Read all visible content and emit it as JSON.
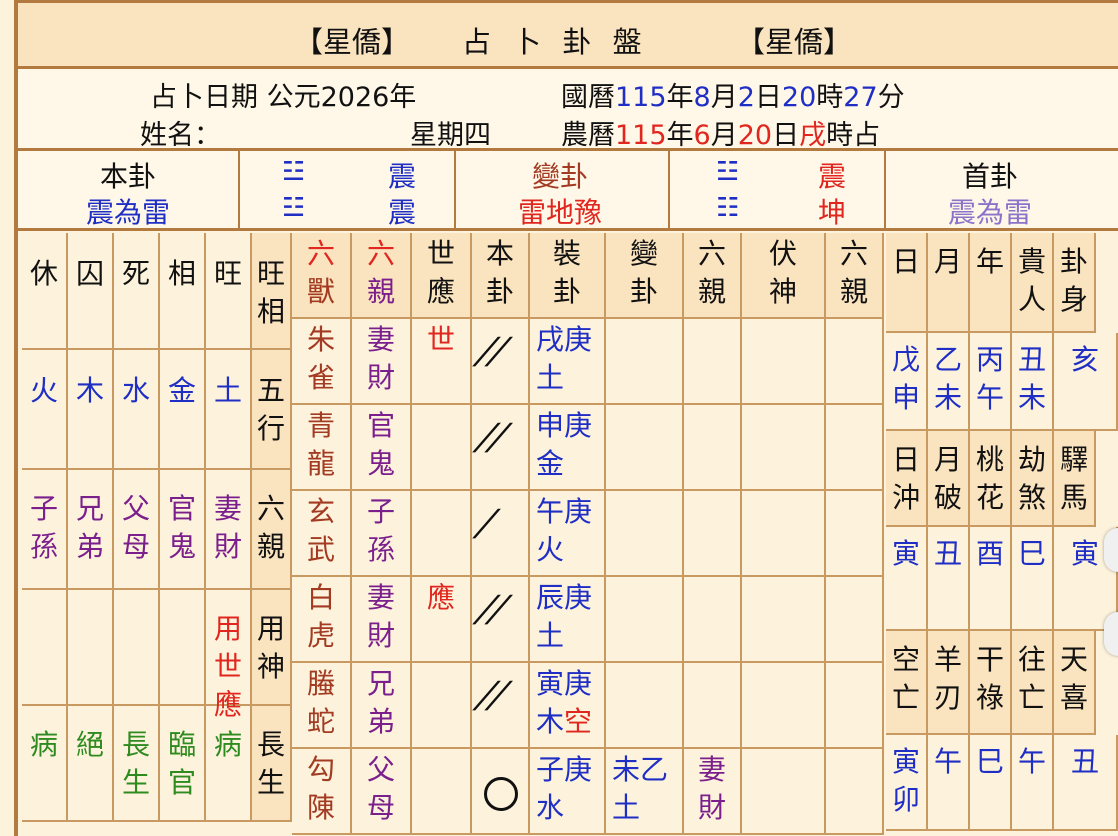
{
  "header": {
    "left_tag": "【星僑】",
    "title": "占 卜 卦 盤",
    "right_tag": "【星僑】"
  },
  "info": {
    "date_label": "占卜日期 公元2026年",
    "name_label": "姓名：",
    "weekday": "星期四",
    "greg_prefix": "國曆",
    "greg_year": "115",
    "greg_y": "年",
    "greg_month": "8",
    "greg_m": "月",
    "greg_day": "2",
    "greg_d": "日",
    "greg_hour": "20",
    "greg_h": "時",
    "greg_min": "27",
    "greg_mn": "分",
    "lunar_prefix": "農曆",
    "lunar_year": "115",
    "lunar_y": "年",
    "lunar_month": "6",
    "lunar_m": "月",
    "lunar_day": "20",
    "lunar_d": "日",
    "lunar_hour": "戌",
    "lunar_h": "時占"
  },
  "hexagrams": {
    "main_label": "本卦",
    "main_name": "震為雷",
    "main_upper": "震",
    "main_lower": "震",
    "changed_label": "變卦",
    "changed_name": "雷地豫",
    "changed_upper": "震",
    "changed_lower": "坤",
    "first_label": "首卦",
    "first_name": "震為雷",
    "trigram_glyph": "☳",
    "trigram_glyph2": "☷"
  },
  "left_table": {
    "seasons": [
      "休",
      "囚",
      "死",
      "相",
      "旺"
    ],
    "wangxiang": "旺相",
    "elements": [
      "火",
      "木",
      "水",
      "金",
      "土"
    ],
    "wuxing": "五行",
    "kin": [
      "子孫",
      "兄弟",
      "父母",
      "官鬼",
      "妻財"
    ],
    "liuqin": "六親",
    "yong": "用世應",
    "yongshen": "用神",
    "life": [
      "病",
      "絕",
      "長生",
      "臨官",
      "病"
    ],
    "changsheng": "長生"
  },
  "main_table": {
    "headers": [
      "六獸",
      "六親",
      "世應",
      "本卦",
      "裝卦",
      "變卦",
      "六親",
      "伏神",
      "六親"
    ],
    "rows": [
      {
        "beast": "朱雀",
        "kin": "妻財",
        "shiying": "世",
        "line": "//",
        "branch": "戌庚",
        "elem": "土",
        "chg": "",
        "chgkin": ""
      },
      {
        "beast": "青龍",
        "kin": "官鬼",
        "shiying": "",
        "line": "//",
        "branch": "申庚",
        "elem": "金",
        "chg": "",
        "chgkin": ""
      },
      {
        "beast": "玄武",
        "kin": "子孫",
        "shiying": "",
        "line": "/",
        "branch": "午庚",
        "elem": "火",
        "chg": "",
        "chgkin": ""
      },
      {
        "beast": "白虎",
        "kin": "妻財",
        "shiying": "應",
        "line": "//",
        "branch": "辰庚",
        "elem": "土",
        "chg": "",
        "chgkin": ""
      },
      {
        "beast": "螣蛇",
        "kin": "兄弟",
        "shiying": "",
        "line": "//",
        "branch": "寅庚",
        "elem": "木",
        "elem_extra": "空",
        "chg": "",
        "chgkin": ""
      },
      {
        "beast": "勾陳",
        "kin": "父母",
        "shiying": "",
        "line": "○",
        "branch": "子庚",
        "elem": "水",
        "chg": "未乙土",
        "chgkin": "妻財"
      }
    ]
  },
  "right_table": {
    "h1": [
      "日",
      "月",
      "年",
      "貴人",
      "卦身"
    ],
    "v1": [
      "戊申",
      "乙未",
      "丙午",
      "丑未",
      "亥"
    ],
    "h2": [
      "日沖",
      "月破",
      "桃花",
      "劫煞",
      "驛馬"
    ],
    "v2": [
      "寅",
      "丑",
      "酉",
      "巳",
      "寅"
    ],
    "h3": [
      "空亡",
      "羊刃",
      "干祿",
      "往亡",
      "天喜"
    ],
    "v3": [
      "寅卯",
      "午",
      "巳",
      "午",
      "丑"
    ]
  }
}
